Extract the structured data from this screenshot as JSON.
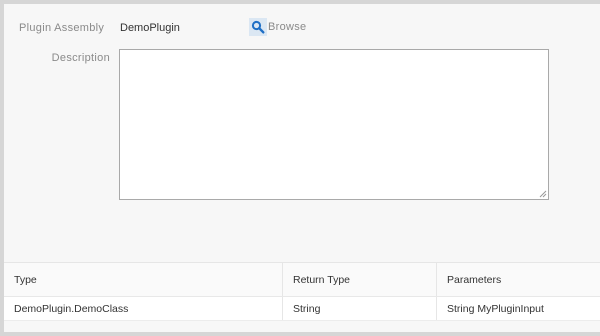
{
  "form": {
    "plugin_assembly_label": "Plugin Assembly",
    "plugin_assembly_value": "DemoPlugin",
    "browse_label": "Browse",
    "browse_icon": "search-icon",
    "description_label": "Description",
    "description_value": ""
  },
  "table": {
    "headers": [
      "Type",
      "Return Type",
      "Parameters"
    ],
    "rows": [
      [
        "DemoPlugin.DemoClass",
        "String",
        "String MyPluginInput"
      ]
    ]
  },
  "colors": {
    "icon_blue": "#1f6fc5",
    "icon_bg": "#dbe7f3",
    "label_gray": "#8a8a8a"
  }
}
